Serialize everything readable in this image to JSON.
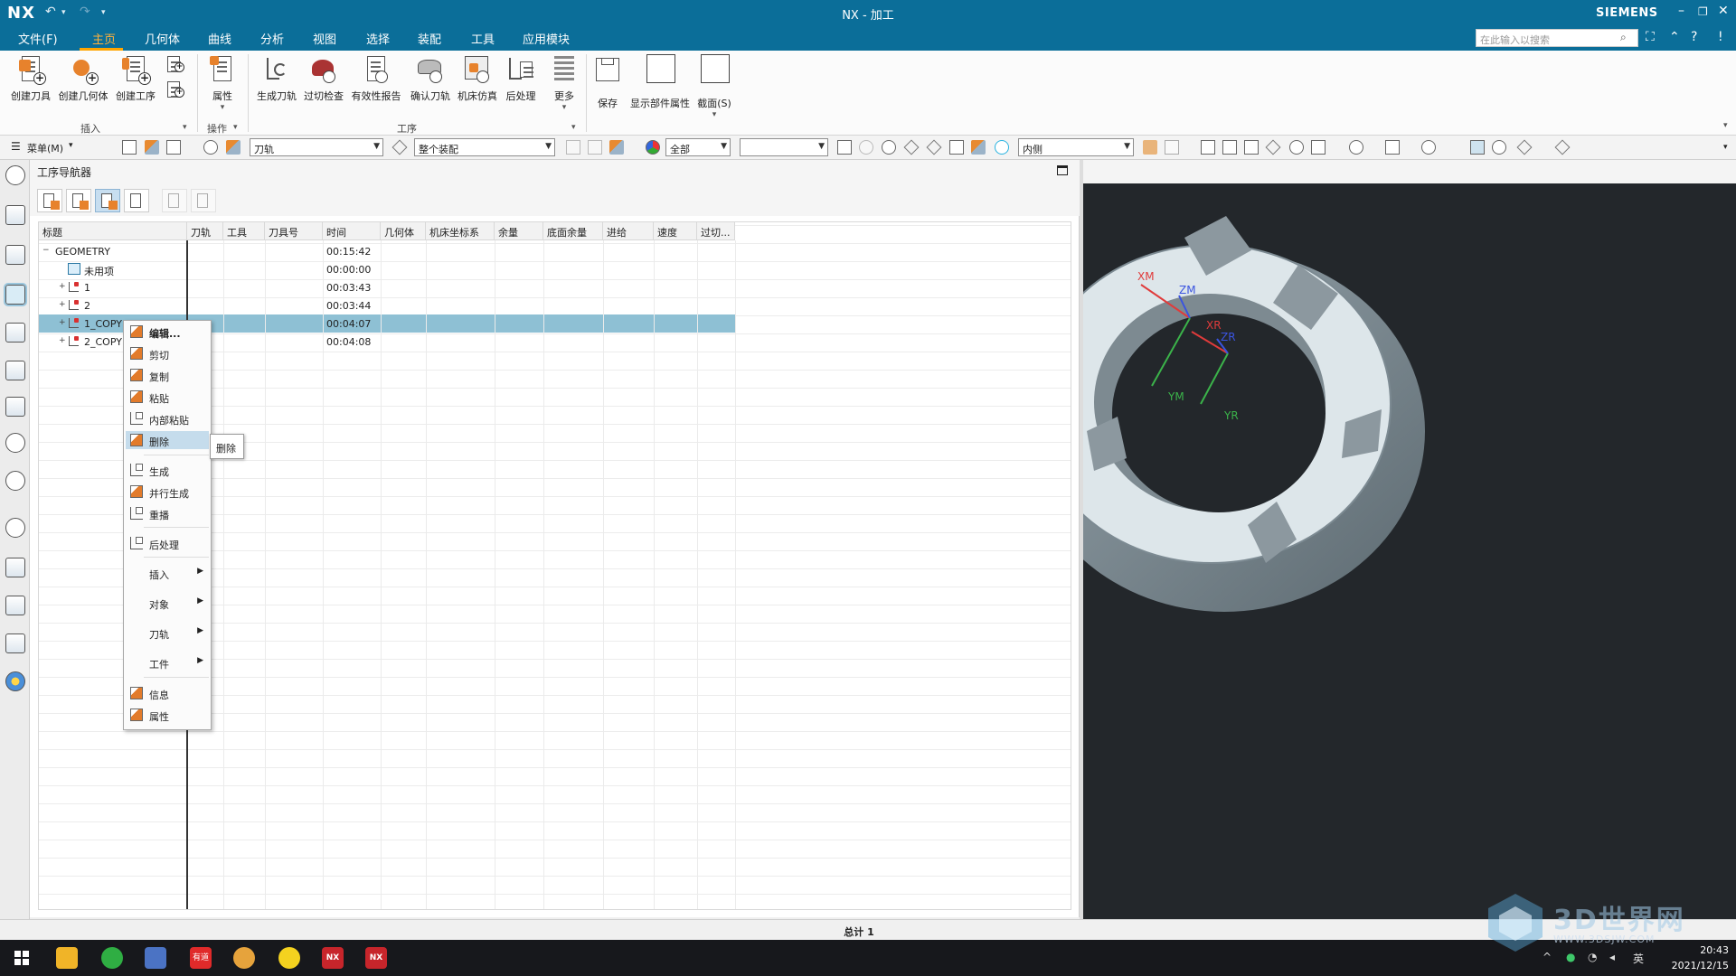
{
  "titlebar": {
    "logo": "NX",
    "title": "NX - 加工",
    "brand": "SIEMENS"
  },
  "menubar": {
    "items": [
      "文件(F)",
      "主页",
      "几何体",
      "曲线",
      "分析",
      "视图",
      "选择",
      "装配",
      "工具",
      "应用模块"
    ],
    "active": "主页",
    "search_placeholder": "在此输入以搜索"
  },
  "ribbon": {
    "buttons": [
      "创建刀具",
      "创建几何体",
      "创建工序",
      "属性",
      "生成刀轨",
      "过切检查",
      "有效性报告",
      "确认刀轨",
      "机床仿真",
      "后处理",
      "更多",
      "保存",
      "显示部件属性",
      "截面(S)"
    ],
    "groups": [
      "插入",
      "操作",
      "工序"
    ]
  },
  "toolbar2": {
    "menu_label": "菜单(M)",
    "filter1": "刀轨",
    "filter2": "整个装配",
    "filter3": "全部",
    "filter4": "",
    "filter5": "内侧"
  },
  "navigator": {
    "title": "工序导航器",
    "columns": [
      "标题",
      "刀轨",
      "工具",
      "刀具号",
      "时间",
      "几何体",
      "机床坐标系",
      "余量",
      "底面余量",
      "进给",
      "速度",
      "过切..."
    ],
    "rows": [
      {
        "name": "GEOMETRY",
        "time": "00:15:42"
      },
      {
        "name": "未用项",
        "time": "00:00:00"
      },
      {
        "name": "1",
        "time": "00:03:43"
      },
      {
        "name": "2",
        "time": "00:03:44"
      },
      {
        "name": "1_COPY",
        "time": "00:04:07"
      },
      {
        "name": "2_COPY",
        "time": "00:04:08"
      }
    ],
    "selected_row": "1_COPY"
  },
  "context_menu": {
    "items": [
      "编辑...",
      "剪切",
      "复制",
      "粘贴",
      "内部粘贴",
      "删除",
      "生成",
      "并行生成",
      "重播",
      "后处理",
      "插入",
      "对象",
      "刀轨",
      "工件",
      "信息",
      "属性"
    ],
    "highlighted": "删除",
    "tooltip": "删除"
  },
  "viewport": {
    "axis_labels": [
      "XM",
      "ZM",
      "XR",
      "ZR",
      "YM",
      "YR"
    ]
  },
  "status": {
    "text": "总计 1"
  },
  "taskbar": {
    "time": "20:43",
    "date": "2021/12/15",
    "ime": "英",
    "app_labels": [
      "有道",
      "NX",
      "NX"
    ]
  },
  "watermark": {
    "text": "3D世界网",
    "url": "WWW.3DSJW.COM"
  },
  "colors": {
    "titlebar": "#0b6e99",
    "accent": "#ffa500",
    "selection": "#8ec0d4",
    "viewport_bg": "#23272b",
    "part": "#8d9ba3"
  }
}
